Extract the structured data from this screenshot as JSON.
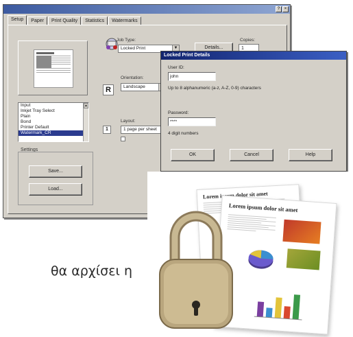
{
  "window": {
    "title": "",
    "tabs": [
      "Setup",
      "Paper",
      "Print Quality",
      "Statistics",
      "Watermarks"
    ],
    "list_items": [
      "Input",
      "Inkjet Tray Select",
      "Plain",
      "Bond",
      "Printer Default",
      "Watermark_CR"
    ],
    "settings_label": "Settings",
    "buttons": {
      "save": "Save...",
      "load": "Load..."
    },
    "job_type_label": "Job Type:",
    "job_type_value": "Locked Print",
    "details_button": "Details...",
    "copies_label": "Copies:",
    "copies_value": "1",
    "orientation_label": "Orientation:",
    "orientation_value": "Landscape",
    "orientation_icon_letter": "R",
    "layout_label": "Layout:",
    "layout_value": "1 page per sheet",
    "layout_icon_text": "1"
  },
  "dialog": {
    "title": "Locked Print Details",
    "user_id_label": "User ID:",
    "user_id_value": "john",
    "hint": "Up to 8 alphanumeric (a-z, A-Z, 0-9) characters",
    "password_label": "Password:",
    "password_value": "****",
    "digits_hint": "4 digit numbers",
    "buttons": {
      "ok": "OK",
      "cancel": "Cancel",
      "help": "Help"
    }
  },
  "photo": {
    "doc_back_title": "Lorem ipsum dolor sit amet",
    "doc_front_title": "Lorem ipsum dolor sit amet",
    "bar_colors": [
      "#7a3fa0",
      "#3b8fd0",
      "#e3c43a",
      "#d9482e",
      "#3c9a4a"
    ],
    "bar_values": [
      0.55,
      0.35,
      0.75,
      0.45,
      0.9
    ]
  },
  "caption": "θα αρχίσει η"
}
